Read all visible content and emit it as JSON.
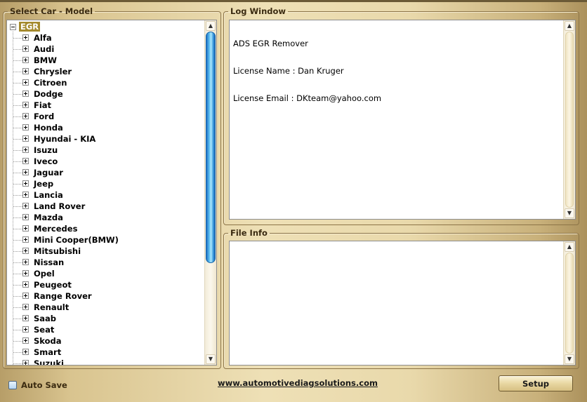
{
  "groups": {
    "select_model": "Select Car - Model",
    "log_window": "Log Window",
    "file_info": "File Info"
  },
  "tree": {
    "root": "EGR",
    "items": [
      "Alfa",
      "Audi",
      "BMW",
      "Chrysler",
      "Citroen",
      "Dodge",
      "Fiat",
      "Ford",
      "Honda",
      "Hyundai - KIA",
      "Isuzu",
      "Iveco",
      "Jaguar",
      "Jeep",
      "Lancia",
      "Land Rover",
      "Mazda",
      "Mercedes",
      "Mini Cooper(BMW)",
      "Mitsubishi",
      "Nissan",
      "Opel",
      "Peugeot",
      "Range Rover",
      "Renault",
      "Saab",
      "Seat",
      "Skoda",
      "Smart",
      "Suzuki"
    ]
  },
  "log": {
    "lines": [
      "ADS EGR Remover",
      "License Name : Dan Kruger",
      "License Email : DKteam@yahoo.com"
    ]
  },
  "file_info": {
    "text": ""
  },
  "footer": {
    "auto_save_label": "Auto Save",
    "url": "www.automotivediagsolutions.com",
    "setup_label": "Setup"
  },
  "scroll": {
    "tree_thumb_fraction": 0.72
  }
}
